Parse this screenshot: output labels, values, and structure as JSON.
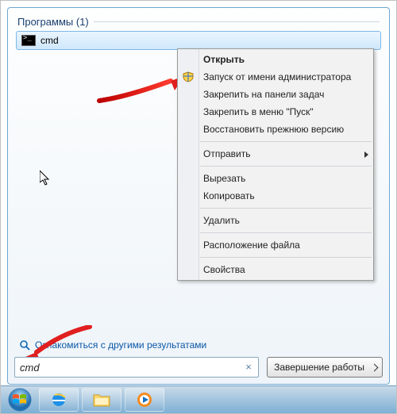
{
  "section": {
    "title": "Программы",
    "count": "(1)"
  },
  "result": {
    "label": "cmd"
  },
  "context_menu": {
    "open": "Открыть",
    "run_as_admin": "Запуск от имени администратора",
    "pin_taskbar": "Закрепить на панели задач",
    "pin_start": "Закрепить в меню \"Пуск\"",
    "restore_prev": "Восстановить прежнюю версию",
    "send_to": "Отправить",
    "cut": "Вырезать",
    "copy": "Копировать",
    "delete": "Удалить",
    "file_location": "Расположение файла",
    "properties": "Свойства"
  },
  "more_results": "Ознакомиться с другими результатами",
  "search": {
    "value": "cmd"
  },
  "shutdown": {
    "label": "Завершение работы"
  }
}
